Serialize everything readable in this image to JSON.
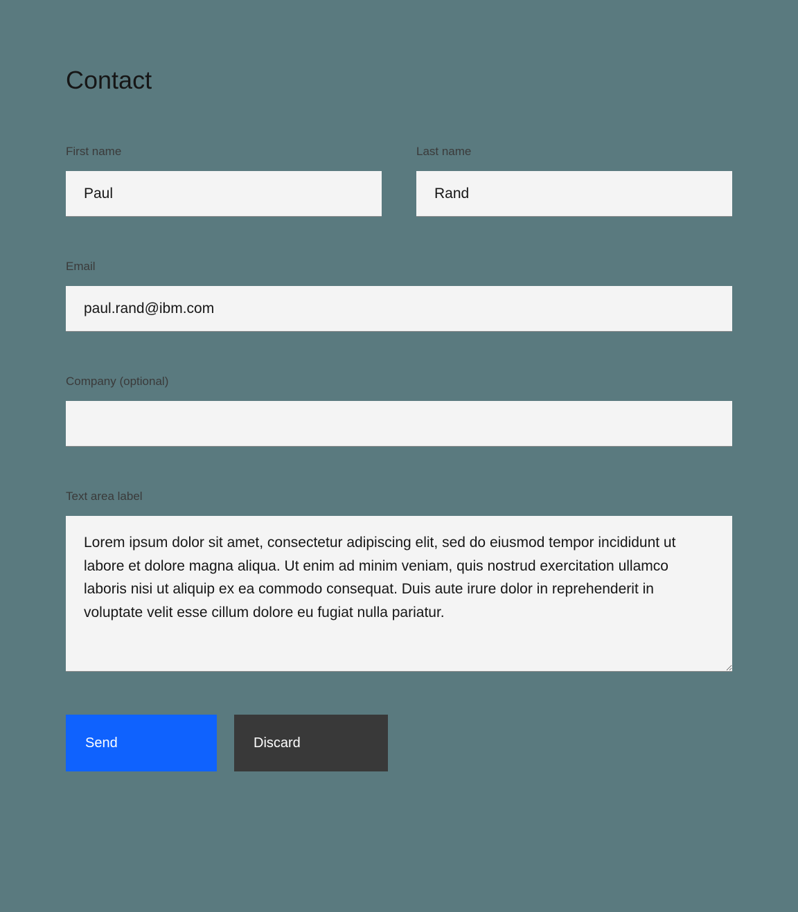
{
  "form": {
    "title": "Contact",
    "fields": {
      "first_name": {
        "label": "First name",
        "value": "Paul"
      },
      "last_name": {
        "label": "Last name",
        "value": "Rand"
      },
      "email": {
        "label": "Email",
        "value": "paul.rand@ibm.com"
      },
      "company": {
        "label": "Company (optional)",
        "value": ""
      },
      "message": {
        "label": "Text area label",
        "value": "Lorem ipsum dolor sit amet, consectetur adipiscing elit, sed do eiusmod tempor incididunt ut labore et dolore magna aliqua. Ut enim ad minim veniam, quis nostrud exercitation ullamco laboris nisi ut aliquip ex ea commodo consequat. Duis aute irure dolor in reprehenderit in voluptate velit esse cillum dolore eu fugiat nulla pariatur."
      }
    },
    "buttons": {
      "send": "Send",
      "discard": "Discard"
    }
  }
}
